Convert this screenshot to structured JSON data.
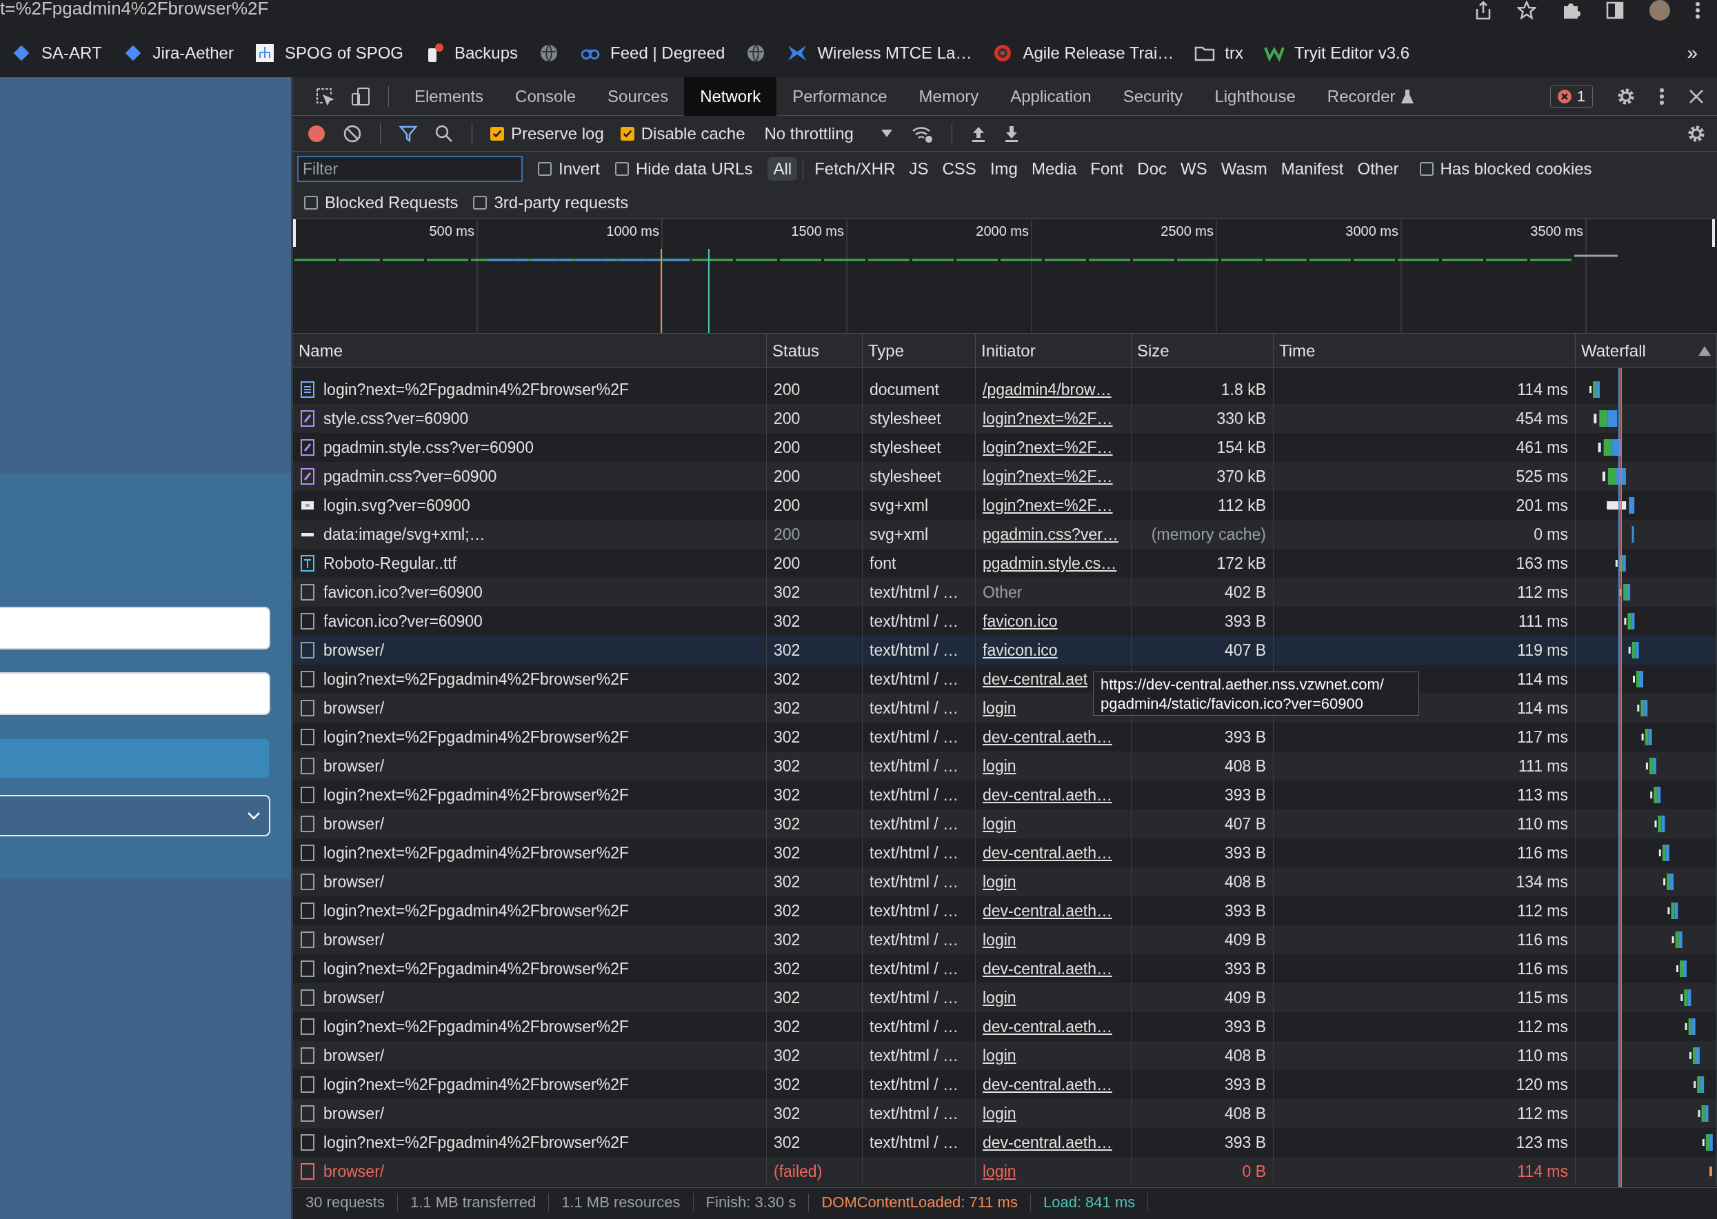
{
  "address_bar": {
    "url_fragment": "t=%2Fpgadmin4%2Fbrowser%2F"
  },
  "bookmarks": [
    {
      "kind": "link",
      "label": "SA-ART"
    },
    {
      "kind": "link",
      "label": "Jira-Aether"
    },
    {
      "kind": "link",
      "label": "SPOG of SPOG"
    },
    {
      "kind": "link",
      "label": "Backups"
    },
    {
      "kind": "icon"
    },
    {
      "kind": "link",
      "label": "Feed | Degreed"
    },
    {
      "kind": "icon"
    },
    {
      "kind": "link",
      "label": "Wireless MTCE La…"
    },
    {
      "kind": "link",
      "label": "Agile Release Trai…"
    },
    {
      "kind": "link",
      "label": "trx"
    },
    {
      "kind": "link",
      "label": "Tryit Editor v3.6"
    },
    {
      "kind": "more",
      "label": "»"
    }
  ],
  "login_form": {
    "fields": [
      {
        "kind": "input"
      },
      {
        "kind": "input"
      },
      {
        "kind": "button"
      },
      {
        "kind": "select"
      }
    ]
  },
  "devtools": {
    "tabs": [
      {
        "label": "Elements",
        "selected": false,
        "experimental": false
      },
      {
        "label": "Console",
        "selected": false,
        "experimental": false
      },
      {
        "label": "Sources",
        "selected": false,
        "experimental": false
      },
      {
        "label": "Network",
        "selected": true,
        "experimental": false
      },
      {
        "label": "Performance",
        "selected": false,
        "experimental": false
      },
      {
        "label": "Memory",
        "selected": false,
        "experimental": false
      },
      {
        "label": "Application",
        "selected": false,
        "experimental": false
      },
      {
        "label": "Security",
        "selected": false,
        "experimental": false
      },
      {
        "label": "Lighthouse",
        "selected": false,
        "experimental": false
      },
      {
        "label": "Recorder",
        "selected": false,
        "experimental": true
      }
    ],
    "error_count": "1",
    "toolbar": {
      "recording": true,
      "filter_active": true,
      "options": [
        {
          "label": "Preserve log",
          "checked": true
        },
        {
          "label": "Disable cache",
          "checked": true
        }
      ],
      "throttling": "No throttling"
    },
    "filter": {
      "placeholder": "Filter",
      "options": [
        {
          "label": "Invert",
          "checked": false
        },
        {
          "label": "Hide data URLs",
          "checked": false
        }
      ],
      "types": [
        {
          "label": "All",
          "selected": true
        },
        {
          "label": "Fetch/XHR",
          "selected": false
        },
        {
          "label": "JS",
          "selected": false
        },
        {
          "label": "CSS",
          "selected": false
        },
        {
          "label": "Img",
          "selected": false
        },
        {
          "label": "Media",
          "selected": false
        },
        {
          "label": "Font",
          "selected": false
        },
        {
          "label": "Doc",
          "selected": false
        },
        {
          "label": "WS",
          "selected": false
        },
        {
          "label": "Wasm",
          "selected": false
        },
        {
          "label": "Manifest",
          "selected": false
        },
        {
          "label": "Other",
          "selected": false
        }
      ],
      "options_after": [
        {
          "label": "Has blocked cookies",
          "checked": false
        }
      ],
      "options_row2": [
        {
          "label": "Blocked Requests",
          "checked": false
        },
        {
          "label": "3rd-party requests",
          "checked": false
        }
      ]
    },
    "overview": {
      "ticks": [
        "500 ms",
        "1000 ms",
        "1500 ms",
        "2000 ms",
        "2500 ms",
        "3000 ms",
        "3500 ms"
      ]
    },
    "columns": [
      "Name",
      "Status",
      "Type",
      "Initiator",
      "Size",
      "Time",
      "Waterfall"
    ],
    "rows": [
      {
        "kind": "document",
        "name": "login?next=%2Fpgadmin4%2Fbrowser%2F",
        "status": "200",
        "type": "document",
        "initiator": "/pgadmin4/brow…",
        "initiator_link": true,
        "size": "1.8 kB",
        "time": "114 ms",
        "selected": false,
        "failed": false,
        "cached": false
      },
      {
        "kind": "stylesheet",
        "name": "style.css?ver=60900",
        "status": "200",
        "type": "stylesheet",
        "initiator": "login?next=%2F…",
        "initiator_link": true,
        "size": "330 kB",
        "time": "454 ms",
        "selected": false,
        "failed": false,
        "cached": false
      },
      {
        "kind": "stylesheet",
        "name": "pgadmin.style.css?ver=60900",
        "status": "200",
        "type": "stylesheet",
        "initiator": "login?next=%2F…",
        "initiator_link": true,
        "size": "154 kB",
        "time": "461 ms",
        "selected": false,
        "failed": false,
        "cached": false
      },
      {
        "kind": "stylesheet",
        "name": "pgadmin.css?ver=60900",
        "status": "200",
        "type": "stylesheet",
        "initiator": "login?next=%2F…",
        "initiator_link": true,
        "size": "370 kB",
        "time": "525 ms",
        "selected": false,
        "failed": false,
        "cached": false
      },
      {
        "kind": "image",
        "name": "login.svg?ver=60900",
        "status": "200",
        "type": "svg+xml",
        "initiator": "login?next=%2F…",
        "initiator_link": true,
        "size": "112 kB",
        "time": "201 ms",
        "selected": false,
        "failed": false,
        "cached": false
      },
      {
        "kind": "data",
        "name": "data:image/svg+xml;…",
        "status": "200",
        "type": "svg+xml",
        "initiator": "pgadmin.css?ver…",
        "initiator_link": true,
        "size": "(memory cache)",
        "time": "0 ms",
        "selected": false,
        "failed": false,
        "cached": true
      },
      {
        "kind": "font",
        "name": "Roboto-Regular..ttf",
        "status": "200",
        "type": "font",
        "initiator": "pgadmin.style.cs…",
        "initiator_link": true,
        "size": "172 kB",
        "time": "163 ms",
        "selected": false,
        "failed": false,
        "cached": false
      },
      {
        "kind": "other",
        "name": "favicon.ico?ver=60900",
        "status": "302",
        "type": "text/html / …",
        "initiator": "Other",
        "initiator_link": false,
        "size": "402 B",
        "time": "112 ms",
        "selected": false,
        "failed": false,
        "cached": false
      },
      {
        "kind": "other",
        "name": "favicon.ico?ver=60900",
        "status": "302",
        "type": "text/html / …",
        "initiator": "favicon.ico",
        "initiator_link": true,
        "size": "393 B",
        "time": "111 ms",
        "selected": false,
        "failed": false,
        "cached": false
      },
      {
        "kind": "other",
        "name": "browser/",
        "status": "302",
        "type": "text/html / …",
        "initiator": "favicon.ico",
        "initiator_link": true,
        "size": "407 B",
        "time": "119 ms",
        "selected": true,
        "failed": false,
        "cached": false
      },
      {
        "kind": "other",
        "name": "login?next=%2Fpgadmin4%2Fbrowser%2F",
        "status": "302",
        "type": "text/html / …",
        "initiator": "dev-central.aet",
        "initiator_link": true,
        "time": "114 ms",
        "selected": false,
        "failed": false,
        "cached": false
      },
      {
        "kind": "other",
        "name": "browser/",
        "status": "302",
        "type": "text/html / …",
        "initiator": "login",
        "initiator_link": true,
        "time": "114 ms",
        "selected": false,
        "failed": false,
        "cached": false
      },
      {
        "kind": "other",
        "name": "login?next=%2Fpgadmin4%2Fbrowser%2F",
        "status": "302",
        "type": "text/html / …",
        "initiator": "dev-central.aeth…",
        "initiator_link": true,
        "size": "393 B",
        "time": "117 ms",
        "selected": false,
        "failed": false,
        "cached": false
      },
      {
        "kind": "other",
        "name": "browser/",
        "status": "302",
        "type": "text/html / …",
        "initiator": "login",
        "initiator_link": true,
        "size": "408 B",
        "time": "111 ms",
        "selected": false,
        "failed": false,
        "cached": false
      },
      {
        "kind": "other",
        "name": "login?next=%2Fpgadmin4%2Fbrowser%2F",
        "status": "302",
        "type": "text/html / …",
        "initiator": "dev-central.aeth…",
        "initiator_link": true,
        "size": "393 B",
        "time": "113 ms",
        "selected": false,
        "failed": false,
        "cached": false
      },
      {
        "kind": "other",
        "name": "browser/",
        "status": "302",
        "type": "text/html / …",
        "initiator": "login",
        "initiator_link": true,
        "size": "407 B",
        "time": "110 ms",
        "selected": false,
        "failed": false,
        "cached": false
      },
      {
        "kind": "other",
        "name": "login?next=%2Fpgadmin4%2Fbrowser%2F",
        "status": "302",
        "type": "text/html / …",
        "initiator": "dev-central.aeth…",
        "initiator_link": true,
        "size": "393 B",
        "time": "116 ms",
        "selected": false,
        "failed": false,
        "cached": false
      },
      {
        "kind": "other",
        "name": "browser/",
        "status": "302",
        "type": "text/html / …",
        "initiator": "login",
        "initiator_link": true,
        "size": "408 B",
        "time": "134 ms",
        "selected": false,
        "failed": false,
        "cached": false
      },
      {
        "kind": "other",
        "name": "login?next=%2Fpgadmin4%2Fbrowser%2F",
        "status": "302",
        "type": "text/html / …",
        "initiator": "dev-central.aeth…",
        "initiator_link": true,
        "size": "393 B",
        "time": "112 ms",
        "selected": false,
        "failed": false,
        "cached": false
      },
      {
        "kind": "other",
        "name": "browser/",
        "status": "302",
        "type": "text/html / …",
        "initiator": "login",
        "initiator_link": true,
        "size": "409 B",
        "time": "116 ms",
        "selected": false,
        "failed": false,
        "cached": false
      },
      {
        "kind": "other",
        "name": "login?next=%2Fpgadmin4%2Fbrowser%2F",
        "status": "302",
        "type": "text/html / …",
        "initiator": "dev-central.aeth…",
        "initiator_link": true,
        "size": "393 B",
        "time": "116 ms",
        "selected": false,
        "failed": false,
        "cached": false
      },
      {
        "kind": "other",
        "name": "browser/",
        "status": "302",
        "type": "text/html / …",
        "initiator": "login",
        "initiator_link": true,
        "size": "409 B",
        "time": "115 ms",
        "selected": false,
        "failed": false,
        "cached": false
      },
      {
        "kind": "other",
        "name": "login?next=%2Fpgadmin4%2Fbrowser%2F",
        "status": "302",
        "type": "text/html / …",
        "initiator": "dev-central.aeth…",
        "initiator_link": true,
        "size": "393 B",
        "time": "112 ms",
        "selected": false,
        "failed": false,
        "cached": false
      },
      {
        "kind": "other",
        "name": "browser/",
        "status": "302",
        "type": "text/html / …",
        "initiator": "login",
        "initiator_link": true,
        "size": "408 B",
        "time": "110 ms",
        "selected": false,
        "failed": false,
        "cached": false
      },
      {
        "kind": "other",
        "name": "login?next=%2Fpgadmin4%2Fbrowser%2F",
        "status": "302",
        "type": "text/html / …",
        "initiator": "dev-central.aeth…",
        "initiator_link": true,
        "size": "393 B",
        "time": "120 ms",
        "selected": false,
        "failed": false,
        "cached": false
      },
      {
        "kind": "other",
        "name": "browser/",
        "status": "302",
        "type": "text/html / …",
        "initiator": "login",
        "initiator_link": true,
        "size": "408 B",
        "time": "112 ms",
        "selected": false,
        "failed": false,
        "cached": false
      },
      {
        "kind": "other",
        "name": "login?next=%2Fpgadmin4%2Fbrowser%2F",
        "status": "302",
        "type": "text/html / …",
        "initiator": "dev-central.aeth…",
        "initiator_link": true,
        "size": "393 B",
        "time": "123 ms",
        "selected": false,
        "failed": false,
        "cached": false
      },
      {
        "kind": "other",
        "name": "browser/",
        "status": "(failed)",
        "initiator": "login",
        "initiator_link": true,
        "size": "0 B",
        "time": "114 ms",
        "selected": false,
        "failed": true,
        "cached": false
      }
    ],
    "tooltip": {
      "text": "https://dev-central.aether.nss.vzwnet.com/\npgadmin4/static/favicon.ico?ver=60900"
    },
    "status_bar": [
      {
        "text": "30 requests",
        "color": "#9aa0a6"
      },
      {
        "text": "1.1 MB transferred",
        "color": "#9aa0a6"
      },
      {
        "text": "1.1 MB resources",
        "color": "#9aa0a6"
      },
      {
        "text": "Finish: 3.30 s",
        "color": "#9aa0a6"
      },
      {
        "text": "DOMContentLoaded: 711 ms",
        "color": "#f28b54"
      },
      {
        "text": "Load: 841 ms",
        "color": "#4fc3b7"
      }
    ]
  }
}
